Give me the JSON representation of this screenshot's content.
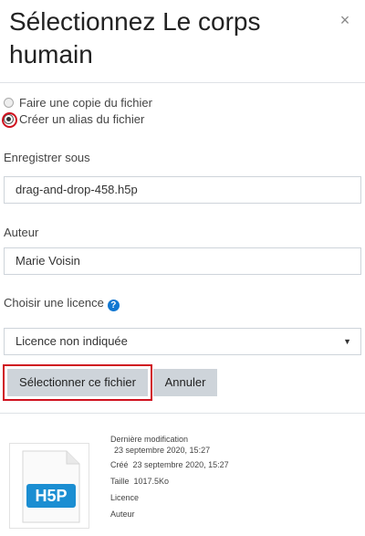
{
  "dialog": {
    "title": "Sélectionnez Le corps humain",
    "close_icon": "close-icon"
  },
  "options": {
    "copy_label": "Faire une copie du fichier",
    "alias_label": "Créer un alias du fichier",
    "selected": "alias"
  },
  "save_as": {
    "label": "Enregistrer sous",
    "value": "drag-and-drop-458.h5p"
  },
  "author": {
    "label": "Auteur",
    "value": "Marie Voisin"
  },
  "license": {
    "label": "Choisir une licence",
    "help_icon": "question-circle-icon",
    "selected": "Licence non indiquée"
  },
  "buttons": {
    "select_label": "Sélectionner ce fichier",
    "cancel_label": "Annuler"
  },
  "file_info": {
    "thumbnail_text": "H5P",
    "modified_label": "Dernière modification",
    "modified_value": "23 septembre 2020, 15:27",
    "created_label": "Créé",
    "created_value": "23 septembre 2020, 15:27",
    "size_label": "Taille",
    "size_value": "1017.5Ko",
    "license_label": "Licence",
    "author_label": "Auteur"
  },
  "colors": {
    "focus_highlight": "#d0121f",
    "help_icon": "#1177d1",
    "button_bg": "#ced4da",
    "h5p_blue": "#1b8ed2"
  }
}
